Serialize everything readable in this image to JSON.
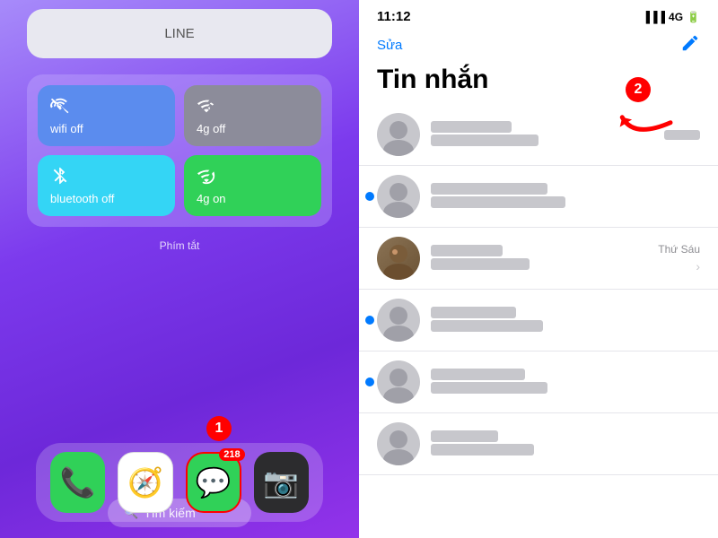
{
  "left": {
    "line_label": "LINE",
    "shortcuts": [
      {
        "id": "wifi",
        "label": "wifi off",
        "color": "blue"
      },
      {
        "id": "4g_off",
        "label": "4g off",
        "color": "gray"
      },
      {
        "id": "bluetooth",
        "label": "bluetooth off",
        "color": "blue-light"
      },
      {
        "id": "4g_on",
        "label": "4g on",
        "color": "green"
      }
    ],
    "phim_tat": "Phím tắt",
    "search_placeholder": "Tìm kiếm",
    "dock_icons": [
      {
        "id": "phone",
        "emoji": "📞",
        "color": "#30d158"
      },
      {
        "id": "safari",
        "emoji": "🧭",
        "color": "#fff"
      },
      {
        "id": "messages",
        "emoji": "💬",
        "color": "#30d158",
        "badge": "218",
        "highlighted": true
      },
      {
        "id": "camera",
        "emoji": "📷",
        "color": "#2c2c2e"
      }
    ],
    "step1_label": "1"
  },
  "right": {
    "status_time": "11:12",
    "signal": "4G",
    "edit_label": "Sửa",
    "tin_nhan_title": "Tin nhắn",
    "step2_label": "2",
    "messages": [
      {
        "id": 1,
        "has_unread": false,
        "name_blur_w": 90,
        "preview_blur_w": 120,
        "time_blur_w": 40
      },
      {
        "id": 2,
        "has_unread": true,
        "name_blur_w": 130,
        "preview_blur_w": 150,
        "time_blur_w": 0
      },
      {
        "id": 3,
        "has_unread": false,
        "has_photo": true,
        "time": "Thứ Sáu",
        "name_blur_w": 80,
        "preview_blur_w": 110
      },
      {
        "id": 4,
        "has_unread": true,
        "name_blur_w": 95,
        "preview_blur_w": 125,
        "time_blur_w": 0
      },
      {
        "id": 5,
        "has_unread": true,
        "name_blur_w": 105,
        "preview_blur_w": 130,
        "time_blur_w": 0
      },
      {
        "id": 6,
        "has_unread": false,
        "name_blur_w": 75,
        "preview_blur_w": 115,
        "time_blur_w": 0
      }
    ]
  }
}
